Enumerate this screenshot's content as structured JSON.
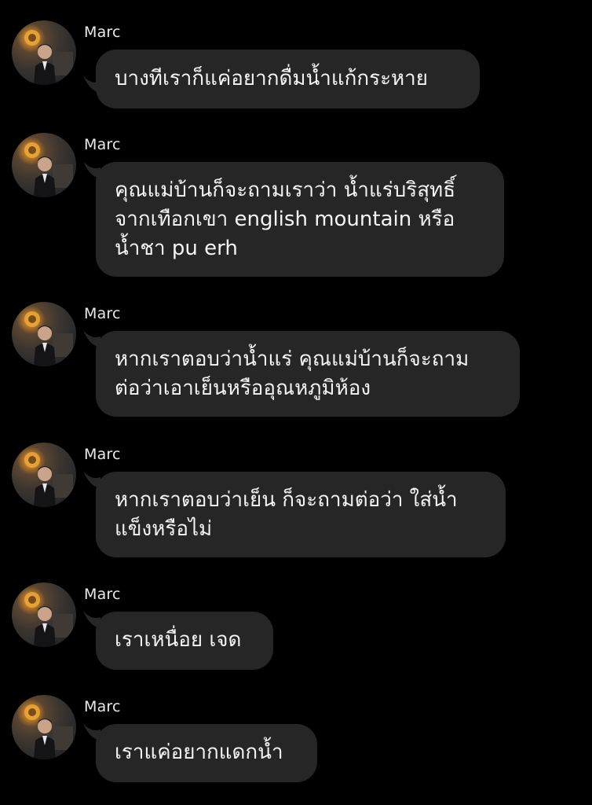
{
  "conversation": {
    "messages": [
      {
        "sender": "Marc",
        "lines": [
          "บางทีเราก็แค่อยากดื่มน้ำแก้กระหาย"
        ]
      },
      {
        "sender": "Marc",
        "lines": [
          "คุณแม่บ้านก็จะถามเราว่า น้ำแร่บริสุทธิ์",
          "จากเทือกเขา english mountain หรือ",
          "น้ำชา pu erh"
        ]
      },
      {
        "sender": "Marc",
        "lines": [
          "หากเราตอบว่าน้ำแร่ คุณแม่บ้านก็จะถาม",
          "ต่อว่าเอาเย็นหรืออุณหภูมิห้อง"
        ]
      },
      {
        "sender": "Marc",
        "lines": [
          "หากเราตอบว่าเย็น ก็จะถามต่อว่า ใส่น้ำ",
          "แข็งหรือไม่"
        ]
      },
      {
        "sender": "Marc",
        "lines": [
          "เราเหนื่อย เจด"
        ]
      },
      {
        "sender": "Marc",
        "lines": [
          "เราแค่อยากแดกน้ำ"
        ]
      }
    ]
  },
  "colors": {
    "background": "#000000",
    "bubble": "#262626",
    "text": "#f4f4f4",
    "sender_text": "#e8e8e8"
  },
  "icons": {
    "avatar": "profile-photo"
  }
}
